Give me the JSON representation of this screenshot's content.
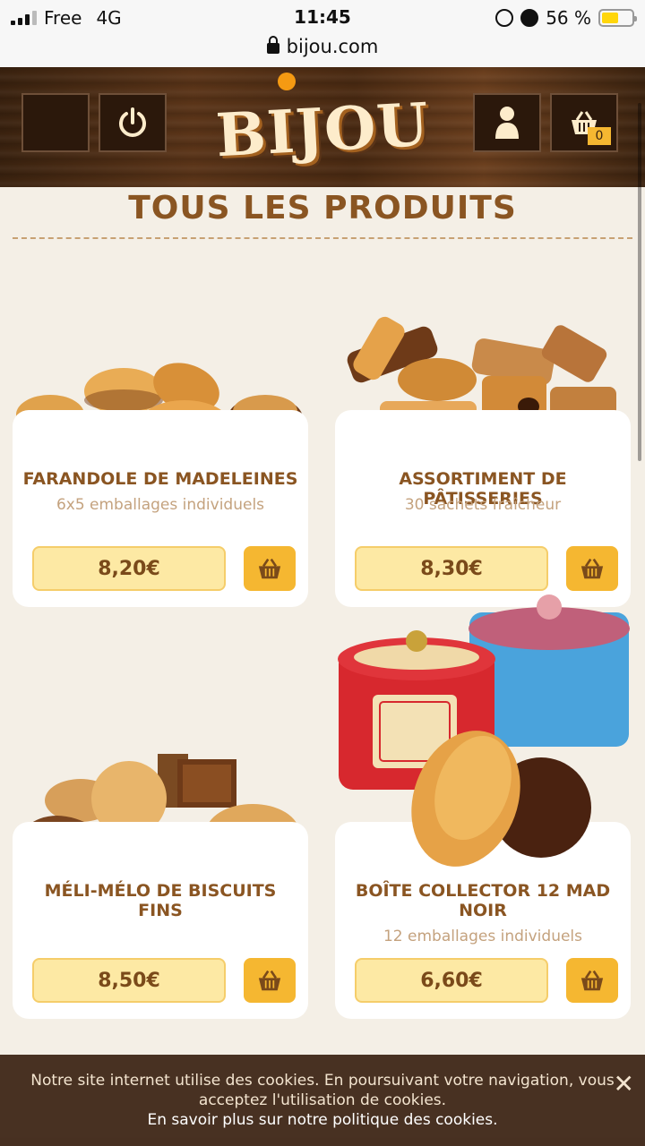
{
  "status_bar": {
    "carrier": "Free",
    "network": "4G",
    "time": "11:45",
    "battery_percent": "56 %",
    "battery_level": 0.56
  },
  "browser": {
    "url": "bijou.com"
  },
  "header": {
    "logo_text": "BIJOU",
    "cart_count": "0"
  },
  "page": {
    "title": "TOUS LES PRODUITS"
  },
  "products": [
    {
      "name": "FARANDOLE DE MADELEINES",
      "subtitle": "6x5 emballages individuels",
      "price": "8,20€"
    },
    {
      "name": "ASSORTIMENT DE PÂTISSERIES",
      "subtitle": "30 sachets fraîcheur",
      "price": "8,30€"
    },
    {
      "name": "MÉLI-MÉLO DE BISCUITS FINS",
      "subtitle": "",
      "price": "8,50€"
    },
    {
      "name": "BOÎTE COLLECTOR 12 MAD NOIR",
      "subtitle": "12 emballages individuels",
      "price": "6,60€"
    }
  ],
  "cookie_banner": {
    "line1": "Notre site internet utilise des cookies. En poursuivant votre navigation, vous",
    "line2": "acceptez l'utilisation de cookies.",
    "line3": "En savoir plus sur notre politique des cookies.",
    "close_label": "✕"
  },
  "colors": {
    "accent": "#f5b731",
    "brand_brown": "#8a5522",
    "price_bg": "#fde9a4"
  }
}
